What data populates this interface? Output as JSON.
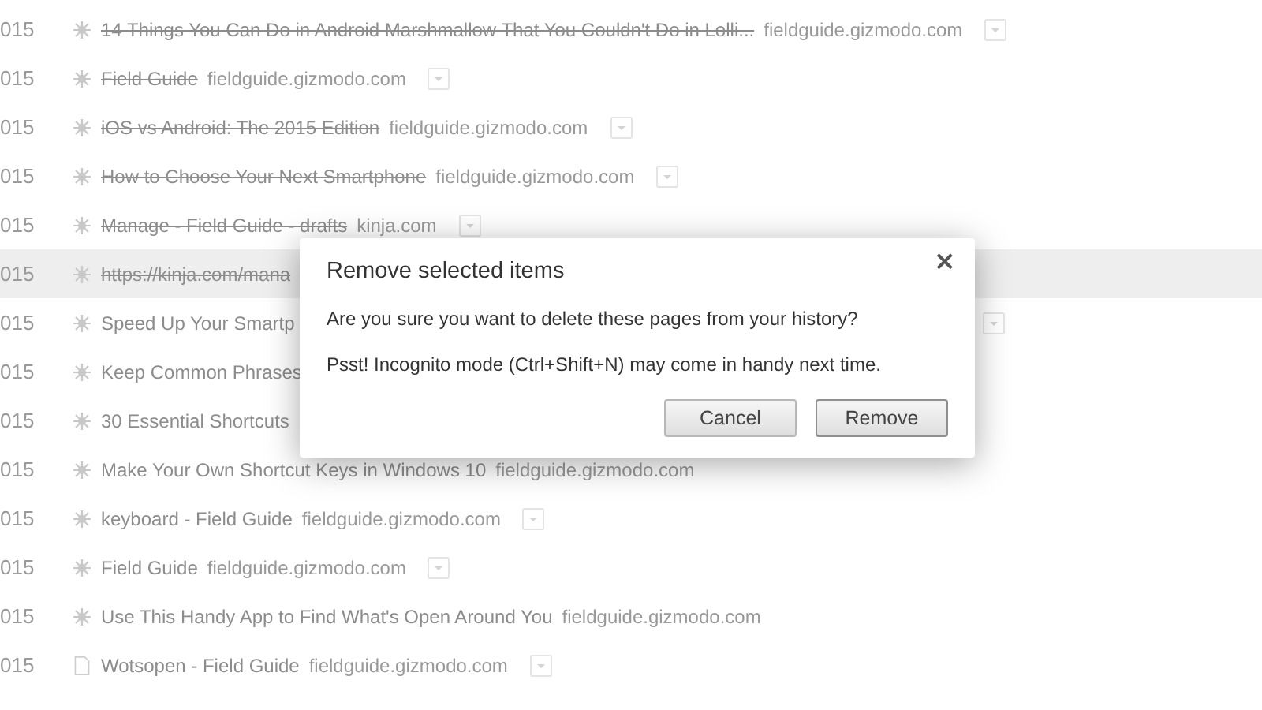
{
  "history": [
    {
      "date": "015",
      "kind": "favicon",
      "title": "14 Things You Can Do in Android Marshmallow That You Couldn't Do in Lolli...",
      "domain": "fieldguide.gizmodo.com",
      "menu": true,
      "removed": true,
      "hovered": false
    },
    {
      "date": "015",
      "kind": "favicon",
      "title": "Field Guide",
      "domain": "fieldguide.gizmodo.com",
      "menu": true,
      "removed": true,
      "hovered": false
    },
    {
      "date": "015",
      "kind": "favicon",
      "title": "iOS vs Android: The 2015 Edition",
      "domain": "fieldguide.gizmodo.com",
      "menu": true,
      "removed": true,
      "hovered": false
    },
    {
      "date": "015",
      "kind": "favicon",
      "title": "How to Choose Your Next Smartphone",
      "domain": "fieldguide.gizmodo.com",
      "menu": true,
      "removed": true,
      "hovered": false
    },
    {
      "date": "015",
      "kind": "favicon",
      "title": "Manage - Field Guide - drafts",
      "domain": "kinja.com",
      "menu": true,
      "removed": true,
      "hovered": false
    },
    {
      "date": "015",
      "kind": "favicon",
      "title": "https://kinja.com/mana",
      "menu": false,
      "removed": true,
      "hovered": true
    },
    {
      "date": "015",
      "kind": "favicon",
      "title": "Speed Up Your Smartp",
      "menu": true,
      "removed": false,
      "hovered": false
    },
    {
      "date": "015",
      "kind": "favicon",
      "title": "Keep Common Phrases",
      "menu": false,
      "removed": false,
      "hovered": false
    },
    {
      "date": "015",
      "kind": "favicon",
      "title": "30 Essential Shortcuts",
      "menu": false,
      "removed": false,
      "hovered": false
    },
    {
      "date": "015",
      "kind": "favicon",
      "title": "Make Your Own Shortcut Keys in Windows 10",
      "domain": "fieldguide.gizmodo.com",
      "menu": false,
      "removed": false,
      "hovered": false
    },
    {
      "date": "015",
      "kind": "favicon",
      "title": "keyboard - Field Guide",
      "domain": "fieldguide.gizmodo.com",
      "menu": true,
      "removed": false,
      "hovered": false
    },
    {
      "date": "015",
      "kind": "favicon",
      "title": "Field Guide",
      "domain": "fieldguide.gizmodo.com",
      "menu": true,
      "removed": false,
      "hovered": false
    },
    {
      "date": "015",
      "kind": "favicon",
      "title": "Use This Handy App to Find What's Open Around You",
      "domain": "fieldguide.gizmodo.com",
      "menu": false,
      "removed": false,
      "hovered": false
    },
    {
      "date": "015",
      "kind": "page",
      "title": "Wotsopen - Field Guide",
      "domain": "fieldguide.gizmodo.com",
      "menu": true,
      "removed": false,
      "hovered": false
    }
  ],
  "dialog": {
    "title": "Remove selected items",
    "message": "Are you sure you want to delete these pages from your history?",
    "hint": "Psst! Incognito mode (Ctrl+Shift+N) may come in handy next time.",
    "close": "×",
    "buttons": [
      {
        "label": "Cancel",
        "kind": "secondary"
      },
      {
        "label": "Remove",
        "kind": "primary"
      }
    ]
  }
}
